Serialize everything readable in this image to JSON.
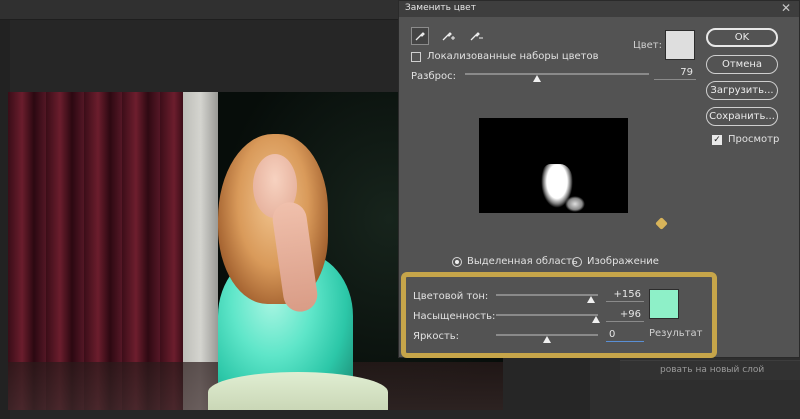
{
  "dialog": {
    "title": "Заменить цвет",
    "close_glyph": "✕",
    "localized_label": "Локализованные наборы цветов",
    "color_label": "Цвет:",
    "color_swatch": "#dedede",
    "fuzziness_label": "Разброс:",
    "fuzziness_value": "79",
    "fuzziness_fraction": 0.39,
    "buttons": {
      "ok": "OK",
      "cancel": "Отмена",
      "load": "Загрузить...",
      "save": "Сохранить..."
    },
    "preview_label": "Просмотр",
    "preview_checked": true,
    "localized_checked": false,
    "radio_selection": "Выделенная область",
    "radio_image": "Изображение",
    "selected_radio": "selection"
  },
  "replacement": {
    "hue_label": "Цветовой тон:",
    "hue_value": "+156",
    "hue_fraction": 0.93,
    "saturation_label": "Насыщенность:",
    "saturation_value": "+96",
    "saturation_fraction": 0.98,
    "lightness_label": "Яркость:",
    "lightness_value": "0",
    "lightness_fraction": 0.5,
    "result_label": "Результат",
    "result_swatch": "#8ef0c8"
  },
  "layers": {
    "partial_text": "ровать на новый слой"
  },
  "icons": {
    "eyedropper": "eyedropper-icon",
    "eyedropper_plus": "eyedropper-plus-icon",
    "eyedropper_minus": "eyedropper-minus-icon"
  },
  "colors": {
    "highlight_border": "#c6a54a",
    "dialog_bg": "#535353"
  }
}
